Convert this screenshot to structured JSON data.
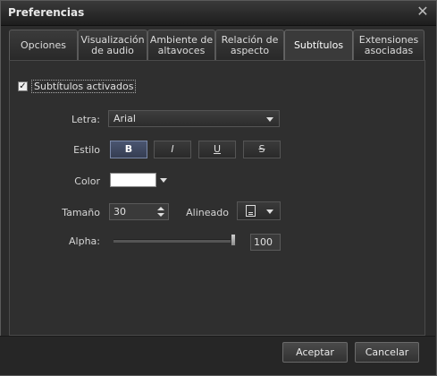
{
  "window": {
    "title": "Preferencias"
  },
  "tabs": [
    {
      "label": "Opciones"
    },
    {
      "label": "Visualización de audio"
    },
    {
      "label": "Ambiente de altavoces"
    },
    {
      "label": "Relación de aspecto"
    },
    {
      "label": "Subtítulos",
      "active": true
    },
    {
      "label": "Extensiones asociadas"
    }
  ],
  "subtitles": {
    "enabled_label": "Subtítulos activados",
    "enabled": true,
    "font_label": "Letra:",
    "font_value": "Arial",
    "style_label": "Estilo",
    "style_buttons": [
      "B",
      "I",
      "U",
      "S"
    ],
    "style_active": "B",
    "color_label": "Color",
    "color_value": "#ffffff",
    "size_label": "Tamaño",
    "size_value": "30",
    "align_label": "Alineado",
    "align_icon": "align-bottom-icon",
    "alpha_label": "Alpha:",
    "alpha_value": "100"
  },
  "buttons": {
    "accept": "Aceptar",
    "cancel": "Cancelar"
  }
}
